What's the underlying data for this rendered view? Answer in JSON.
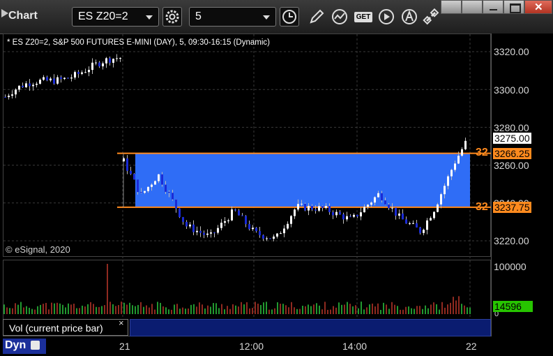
{
  "window": {
    "title": "Chart",
    "symbol": "ES Z20=2",
    "interval": "5"
  },
  "toolbar": {
    "icons": [
      "settings-gear-icon",
      "clock-icon",
      "pencil-icon",
      "chart-style-icon",
      "get-icon",
      "play-icon",
      "alert-icon",
      "link-icon"
    ],
    "get_label": "GET"
  },
  "chart": {
    "symbol_line": "* ES Z20=2, S&P 500 FUTURES E-MINI (DAY), 5, 09:30-16:15 (Dynamic)",
    "copyright": "© eSignal, 2020",
    "price_ticks": [
      "3320.00",
      "3300.00",
      "3280.00",
      "3260.00",
      "3240.00",
      "3220.00"
    ],
    "last_price": "3275.00",
    "zone_high_label": "3266.25",
    "zone_low_label": "3237.75",
    "zone_tag_high": "32",
    "zone_tag_low": "32",
    "time_labels": [
      "21",
      "12:00",
      "14:00",
      "22"
    ],
    "volume_tick": "100000",
    "volume_zero": "0",
    "volume_current": "14596",
    "volume_study_label": "Vol (current price bar)",
    "close_label": "×",
    "dyn_label": "Dyn",
    "colors": {
      "zone_fill": "#2f6df6",
      "zone_line": "#ff8a1e",
      "up_candle": "#ffffff",
      "down_candle": "#1a2bd6",
      "vol_up": "#2ecc40",
      "vol_down": "#c0392b",
      "volume_box": "#27c400"
    }
  },
  "chart_data": {
    "type": "candlestick",
    "ylim": [
      3215,
      3330
    ],
    "zone": {
      "high": 3266.25,
      "low": 3237.75
    },
    "session_1": {
      "time": "21",
      "approx_range": [
        3292,
        3318
      ]
    },
    "session_2_start": {
      "time": "21"
    },
    "x_ticks": [
      "21",
      "12:00",
      "14:00",
      "22"
    ],
    "last": 3275.0,
    "volume_last": 14596
  }
}
